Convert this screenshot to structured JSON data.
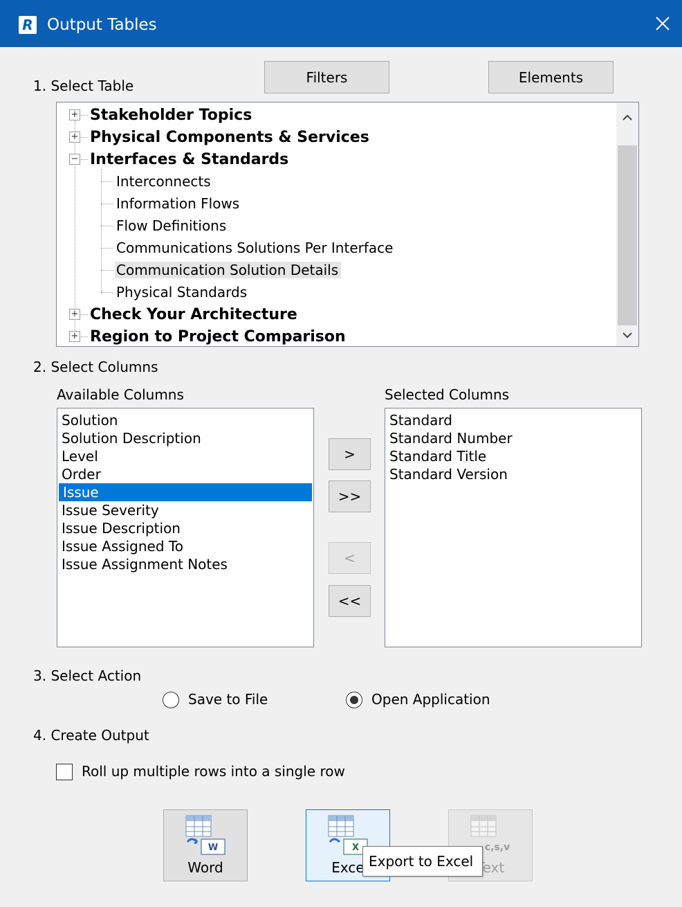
{
  "window": {
    "title": "Output Tables",
    "app_icon_letter": "R",
    "close_icon": "close-icon"
  },
  "toolbar": {
    "filters_label": "Filters",
    "elements_label": "Elements"
  },
  "section1": {
    "label": "1. Select Table",
    "tree": [
      {
        "label": "Stakeholder Topics",
        "expanded": false
      },
      {
        "label": "Physical Components & Services",
        "expanded": false
      },
      {
        "label": "Interfaces & Standards",
        "expanded": true,
        "children": [
          "Interconnects",
          "Information Flows",
          "Flow Definitions",
          "Communications Solutions Per Interface",
          "Communication Solution Details",
          "Physical Standards"
        ],
        "selected_child": "Communication Solution Details"
      },
      {
        "label": "Check Your Architecture",
        "expanded": false
      },
      {
        "label": "Region to Project Comparison",
        "expanded": false
      }
    ]
  },
  "section2": {
    "label": "2. Select Columns",
    "available_label": "Available Columns",
    "selected_label": "Selected Columns",
    "available": [
      "Solution",
      "Solution Description",
      "Level",
      "Order",
      "Issue",
      "Issue Severity",
      "Issue Description",
      "Issue Assigned To",
      "Issue Assignment Notes"
    ],
    "available_selected": "Issue",
    "selected": [
      "Standard",
      "Standard Number",
      "Standard Title",
      "Standard Version"
    ],
    "move_buttons": {
      "add": ">",
      "add_all": ">>",
      "remove": "<",
      "remove_all": "<<"
    }
  },
  "section3": {
    "label": "3. Select Action",
    "options": [
      "Save to File",
      "Open Application"
    ],
    "selected_option": "Open Application"
  },
  "section4": {
    "label": "4. Create Output",
    "rollup_label": "Roll up multiple rows into a single row",
    "rollup_checked": false,
    "outputs": [
      {
        "label": "Word",
        "enabled": true
      },
      {
        "label": "Exce",
        "enabled": true,
        "focused": true
      },
      {
        "label": "Text",
        "enabled": false
      }
    ],
    "tooltip": "Export to Excel",
    "csv_badge": "c,s,v"
  },
  "colors": {
    "title_bar": "#0a5fb4",
    "selection": "#0078d7"
  }
}
